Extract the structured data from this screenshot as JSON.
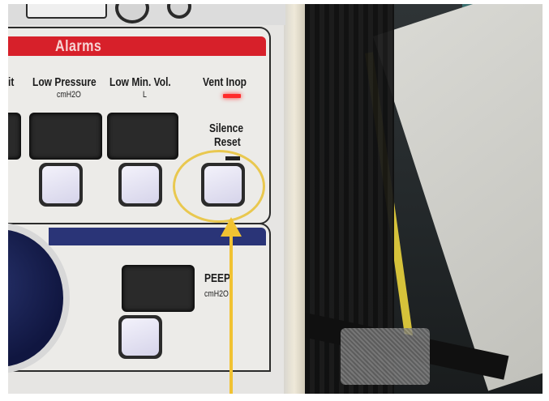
{
  "image": {
    "alarms_header": "Alarms",
    "labels": {
      "truncated_left": "it",
      "low_pressure": "Low Pressure",
      "low_pressure_unit": "cmH2O",
      "low_min_vol": "Low Min. Vol.",
      "low_min_vol_unit": "L",
      "vent_inop": "Vent Inop",
      "silence": "Silence",
      "reset": "Reset",
      "peep": "PEEP",
      "peep_unit": "cmH2O"
    },
    "colors": {
      "alarm_bar": "#d7202a",
      "peep_bar": "#2a3477",
      "highlight_circle": "#e9c84f",
      "arrow": "#f1c232",
      "vent_inop_led": "#ff2a2a"
    }
  }
}
